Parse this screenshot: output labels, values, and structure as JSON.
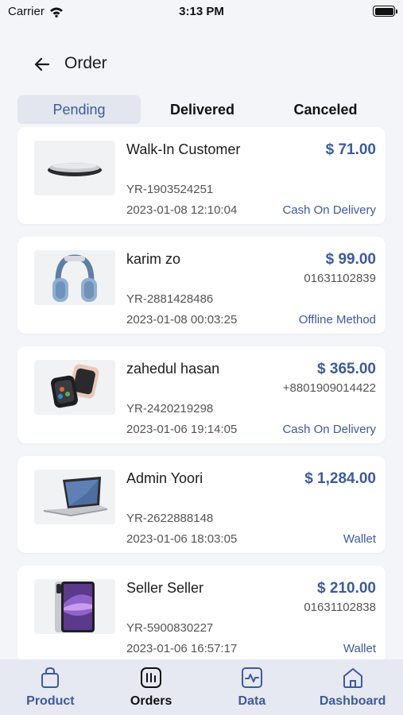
{
  "status_bar": {
    "carrier": "Carrier",
    "time": "3:13 PM"
  },
  "header": {
    "title": "Order",
    "back_icon": "arrow-left-icon"
  },
  "tabs": [
    {
      "label": "Pending",
      "active": true
    },
    {
      "label": "Delivered",
      "active": false
    },
    {
      "label": "Canceled",
      "active": false
    }
  ],
  "orders": [
    {
      "customer": "Walk-In Customer",
      "amount": "$ 71.00",
      "phone": "",
      "order_id": "YR-1903524251",
      "date": "2023-01-08 12:10:04",
      "payment": "Cash On Delivery",
      "image_icon": "mouse-icon"
    },
    {
      "customer": "karim zo",
      "amount": "$ 99.00",
      "phone": "01631102839",
      "order_id": "YR-2881428486",
      "date": "2023-01-08 00:03:25",
      "payment": "Offline Method",
      "image_icon": "headphones-icon"
    },
    {
      "customer": "zahedul hasan",
      "amount": "$ 365.00",
      "phone": "+8801909014422",
      "order_id": "YR-2420219298",
      "date": "2023-01-06 19:14:05",
      "payment": "Cash On Delivery",
      "image_icon": "smartwatch-icon"
    },
    {
      "customer": "Admin Yoori",
      "amount": "$ 1,284.00",
      "phone": "",
      "order_id": "YR-2622888148",
      "date": "2023-01-06 18:03:05",
      "payment": "Wallet",
      "image_icon": "laptop-icon"
    },
    {
      "customer": "Seller Seller",
      "amount": "$ 210.00",
      "phone": "01631102838",
      "order_id": "YR-5900830227",
      "date": "2023-01-06 16:57:17",
      "payment": "Wallet",
      "image_icon": "tablet-icon"
    }
  ],
  "bottom_nav": [
    {
      "label": "Product",
      "icon": "bag-icon",
      "active": false
    },
    {
      "label": "Orders",
      "icon": "orders-icon",
      "active": true
    },
    {
      "label": "Data",
      "icon": "chart-icon",
      "active": false
    },
    {
      "label": "Dashboard",
      "icon": "home-icon",
      "active": false
    }
  ],
  "colors": {
    "accent": "#3d5a9e",
    "background": "#f4f5f9",
    "nav_background": "#e6e9f1",
    "tab_active_bg": "#e3e6ef"
  }
}
